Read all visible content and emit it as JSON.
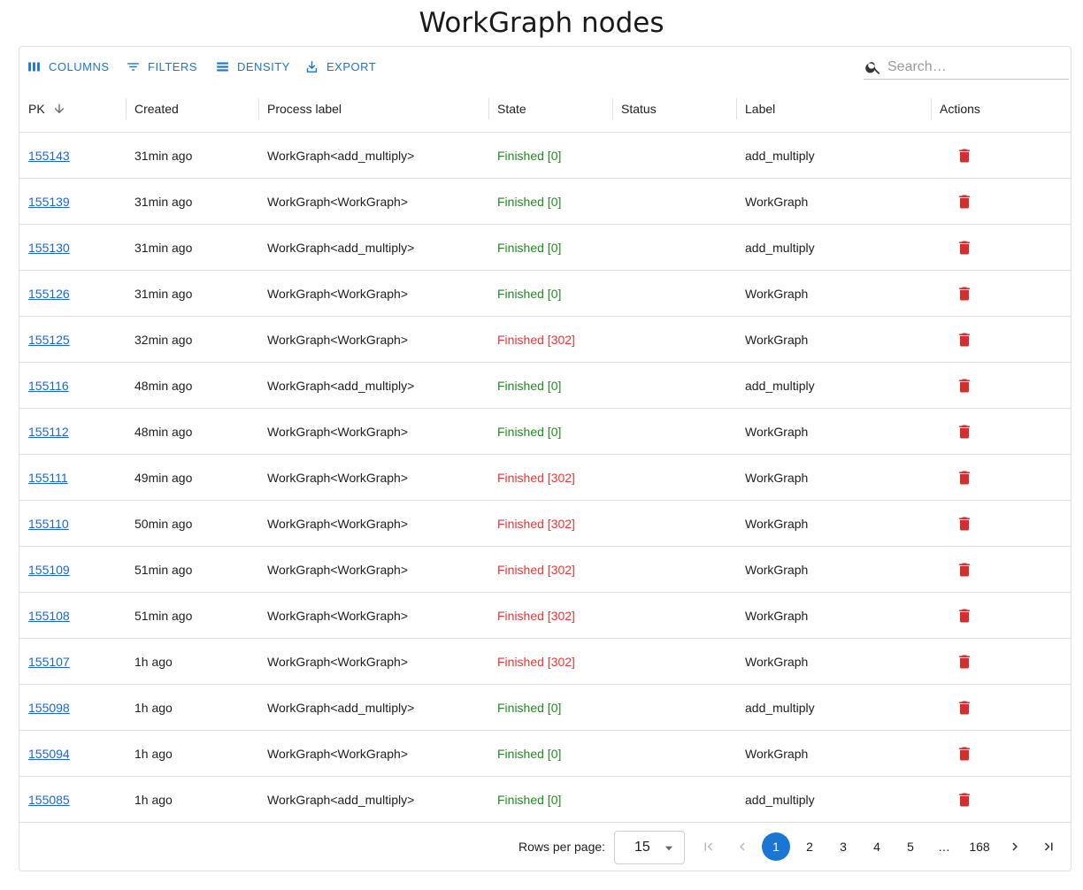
{
  "page": {
    "title": "WorkGraph nodes"
  },
  "toolbar": {
    "columns": "Columns",
    "filters": "Filters",
    "density": "Density",
    "export": "Export",
    "search_placeholder": "Search…"
  },
  "columns": {
    "pk": "PK",
    "created": "Created",
    "process_label": "Process label",
    "state": "State",
    "status": "Status",
    "label": "Label",
    "actions": "Actions"
  },
  "rows": [
    {
      "pk": "155143",
      "created": "31min ago",
      "process_label": "WorkGraph<add_multiply>",
      "state": "Finished [0]",
      "status": "",
      "label": "add_multiply"
    },
    {
      "pk": "155139",
      "created": "31min ago",
      "process_label": "WorkGraph<WorkGraph>",
      "state": "Finished [0]",
      "status": "",
      "label": "WorkGraph"
    },
    {
      "pk": "155130",
      "created": "31min ago",
      "process_label": "WorkGraph<add_multiply>",
      "state": "Finished [0]",
      "status": "",
      "label": "add_multiply"
    },
    {
      "pk": "155126",
      "created": "31min ago",
      "process_label": "WorkGraph<WorkGraph>",
      "state": "Finished [0]",
      "status": "",
      "label": "WorkGraph"
    },
    {
      "pk": "155125",
      "created": "32min ago",
      "process_label": "WorkGraph<WorkGraph>",
      "state": "Finished [302]",
      "status": "",
      "label": "WorkGraph"
    },
    {
      "pk": "155116",
      "created": "48min ago",
      "process_label": "WorkGraph<add_multiply>",
      "state": "Finished [0]",
      "status": "",
      "label": "add_multiply"
    },
    {
      "pk": "155112",
      "created": "48min ago",
      "process_label": "WorkGraph<WorkGraph>",
      "state": "Finished [0]",
      "status": "",
      "label": "WorkGraph"
    },
    {
      "pk": "155111",
      "created": "49min ago",
      "process_label": "WorkGraph<WorkGraph>",
      "state": "Finished [302]",
      "status": "",
      "label": "WorkGraph"
    },
    {
      "pk": "155110",
      "created": "50min ago",
      "process_label": "WorkGraph<WorkGraph>",
      "state": "Finished [302]",
      "status": "",
      "label": "WorkGraph"
    },
    {
      "pk": "155109",
      "created": "51min ago",
      "process_label": "WorkGraph<WorkGraph>",
      "state": "Finished [302]",
      "status": "",
      "label": "WorkGraph"
    },
    {
      "pk": "155108",
      "created": "51min ago",
      "process_label": "WorkGraph<WorkGraph>",
      "state": "Finished [302]",
      "status": "",
      "label": "WorkGraph"
    },
    {
      "pk": "155107",
      "created": "1h ago",
      "process_label": "WorkGraph<WorkGraph>",
      "state": "Finished [302]",
      "status": "",
      "label": "WorkGraph"
    },
    {
      "pk": "155098",
      "created": "1h ago",
      "process_label": "WorkGraph<add_multiply>",
      "state": "Finished [0]",
      "status": "",
      "label": "add_multiply"
    },
    {
      "pk": "155094",
      "created": "1h ago",
      "process_label": "WorkGraph<WorkGraph>",
      "state": "Finished [0]",
      "status": "",
      "label": "WorkGraph"
    },
    {
      "pk": "155085",
      "created": "1h ago",
      "process_label": "WorkGraph<add_multiply>",
      "state": "Finished [0]",
      "status": "",
      "label": "add_multiply"
    }
  ],
  "pagination": {
    "rows_per_page_label": "Rows per page:",
    "rows_per_page": "15",
    "pages": [
      "1",
      "2",
      "3",
      "4",
      "5",
      "…",
      "168"
    ],
    "current_page": "1"
  },
  "colors": {
    "accent": "#1976d2",
    "link": "#1a66d6",
    "state_ok": "#228b22",
    "state_error": "#e53935",
    "delete": "#d32f2f"
  },
  "icons": {
    "columns": "columns-icon",
    "filters": "filter-icon",
    "density": "density-icon",
    "export": "export-icon",
    "search": "search-icon",
    "sort": "arrow-down-icon",
    "delete": "delete-icon"
  }
}
